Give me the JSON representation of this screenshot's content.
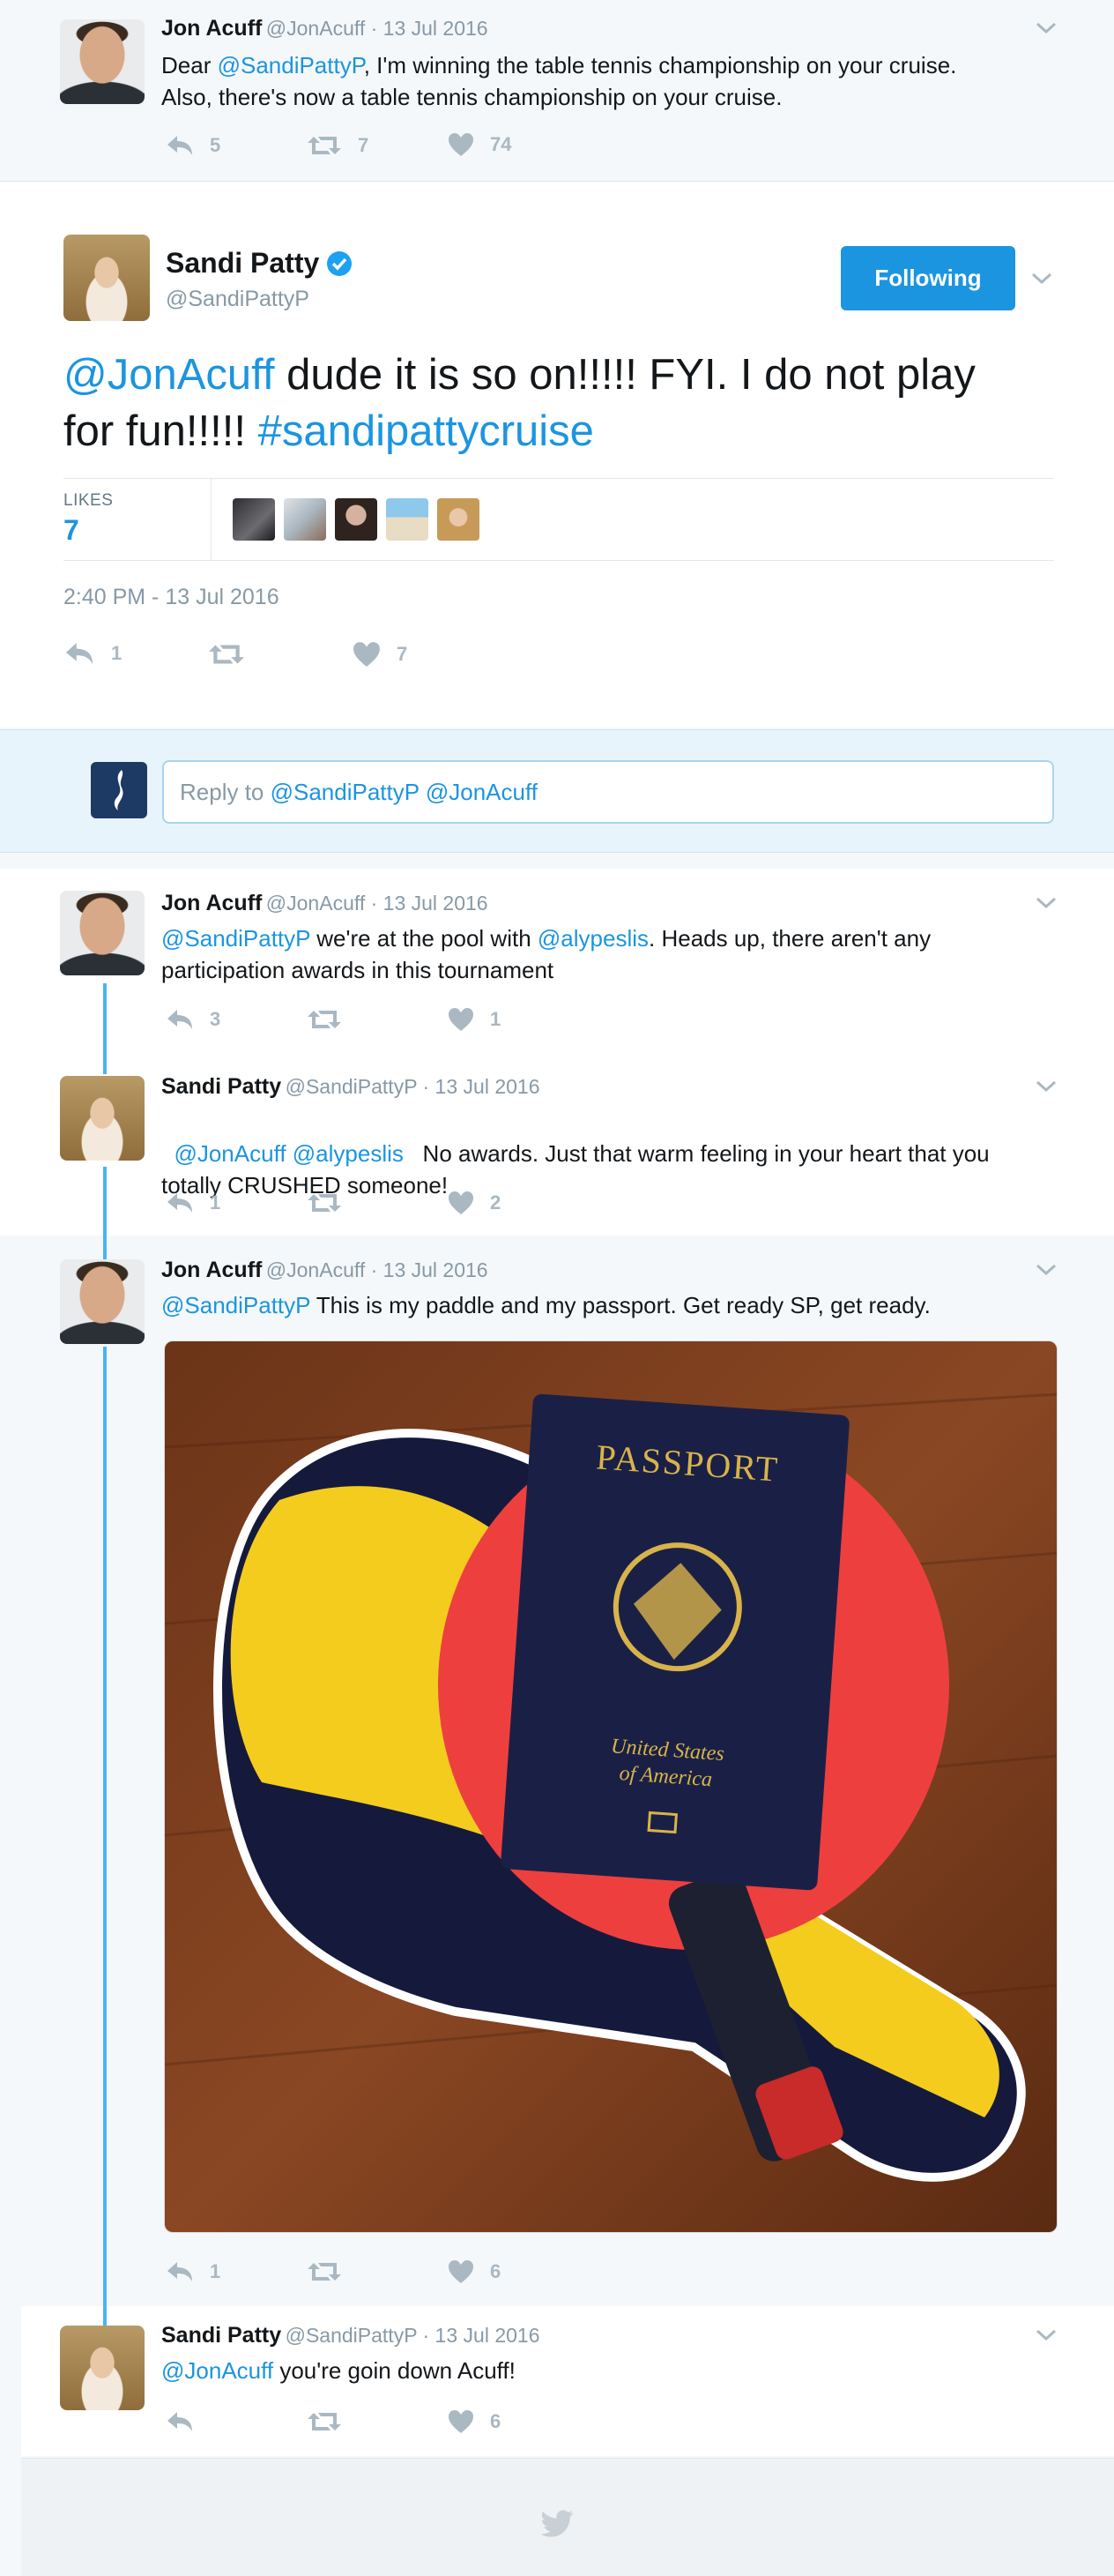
{
  "tweet_top": {
    "name": "Jon Acuff",
    "meta": "@JonAcuff · 13 Jul 2016",
    "text_pre": "Dear ",
    "mention": "@SandiPattyP",
    "text_post": ", I'm winning the table tennis championship on your cruise.",
    "text_line2": "Also, there's now a table tennis championship on your cruise.",
    "replies": "5",
    "retweets": "7",
    "likes": "74"
  },
  "main_tweet": {
    "name": "Sandi Patty",
    "handle": "@SandiPattyP",
    "follow_label": "Following",
    "mention": "@JonAcuff",
    "text_a": " dude it is so on!!!!! FYI.  I do not play",
    "text_b": "for fun!!!!! ",
    "hashtag": "#sandipattycruise",
    "likes_label": "LIKES",
    "likes_count": "7",
    "timestamp": "2:40 PM - 13 Jul 2016",
    "replies": "1",
    "retweets": "",
    "likes": "7"
  },
  "reply_box": {
    "prefix": "Reply to ",
    "mentions": "@SandiPattyP @JonAcuff"
  },
  "thread": [
    {
      "name": "Jon Acuff",
      "meta": "@JonAcuff · 13 Jul 2016",
      "m1": "@SandiPattyP",
      "t1": " we're at the pool with ",
      "m2": "@alypeslis",
      "t2": ". Heads up, there aren't any",
      "line2": "participation awards in this tournament",
      "replies": "3",
      "retweets": "",
      "likes": "1"
    },
    {
      "name": "Sandi Patty",
      "meta": "@SandiPattyP · 13 Jul 2016",
      "m1": "@JonAcuff @alypeslis",
      "t1": "   No awards. Just that warm feeling in your heart that you",
      "line2": "totally CRUSHED someone!",
      "replies": "1",
      "retweets": "",
      "likes": "2"
    },
    {
      "name": "Jon Acuff",
      "meta": "@JonAcuff · 13 Jul 2016",
      "m1": "@SandiPattyP",
      "t1": " This is my paddle and my passport. Get ready SP, get ready.",
      "passport_title": "PASSPORT",
      "passport_country_1": "United States",
      "passport_country_2": "of America",
      "replies": "1",
      "retweets": "",
      "likes": "6"
    },
    {
      "name": "Sandi Patty",
      "meta": "@SandiPattyP · 13 Jul 2016",
      "m1": "@JonAcuff",
      "t1": " you're goin down Acuff!",
      "replies": "",
      "retweets": "",
      "likes": "6"
    }
  ],
  "colors": {
    "link": "#1b95e0",
    "thread_line": "#4ab3f4",
    "muted": "#8899a6",
    "follow_button": "#1b95e0"
  }
}
